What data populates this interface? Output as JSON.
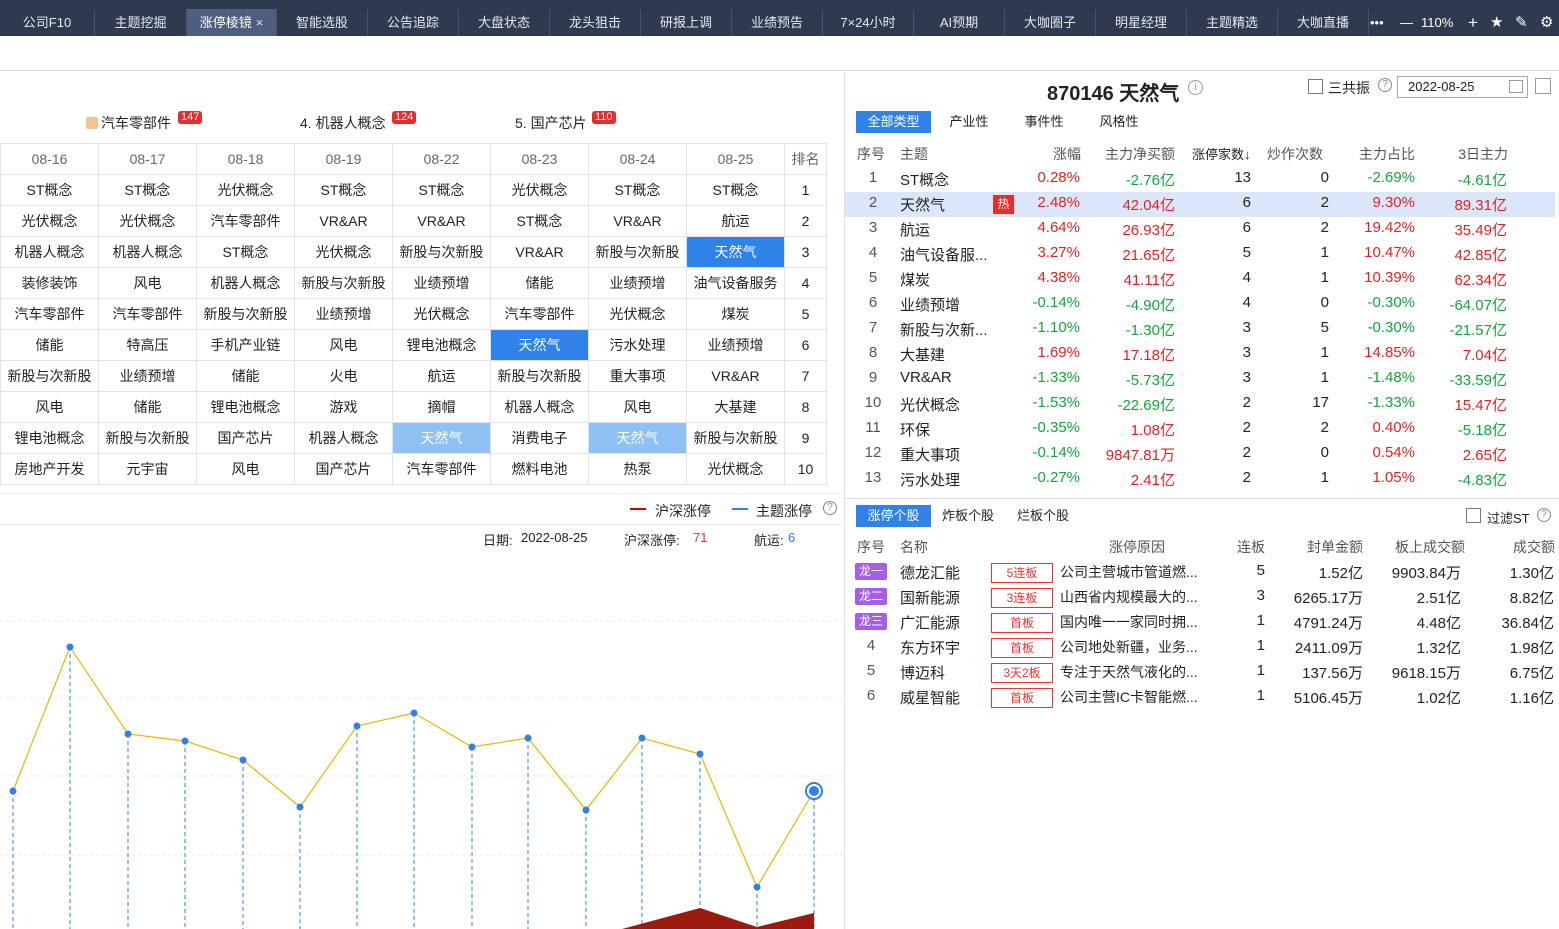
{
  "tabs": [
    "公司F10",
    "主题挖掘",
    "涨停棱镜",
    "智能选股",
    "公告追踪",
    "大盘状态",
    "龙头狙击",
    "研报上调",
    "业绩预告",
    "7×24小时",
    "AI预期",
    "大咖圈子",
    "明星经理",
    "主题精选",
    "大咖直播"
  ],
  "active_tab": "涨停棱镜",
  "toolbar": {
    "more": "•••",
    "minus": "—",
    "zoom": "110%",
    "plus": "+",
    "star": "★",
    "edit": "✎",
    "settings": "⚙"
  },
  "legend": [
    {
      "label": "汽车零部件",
      "count": "147"
    },
    {
      "label": "4. 机器人概念",
      "count": "124"
    },
    {
      "label": "5. 国产芯片",
      "count": "110"
    }
  ],
  "grid": {
    "dates": [
      "08-16",
      "08-17",
      "08-18",
      "08-19",
      "08-22",
      "08-23",
      "08-24",
      "08-25"
    ],
    "rank_header": "排名",
    "rows": [
      [
        "ST概念",
        "ST概念",
        "光伏概念",
        "ST概念",
        "ST概念",
        "光伏概念",
        "ST概念",
        "ST概念",
        "1"
      ],
      [
        "光伏概念",
        "光伏概念",
        "汽车零部件",
        "VR&AR",
        "VR&AR",
        "ST概念",
        "VR&AR",
        "航运",
        "2"
      ],
      [
        "机器人概念",
        "机器人概念",
        "ST概念",
        "光伏概念",
        "新股与次新股",
        "VR&AR",
        "新股与次新股",
        "天然气",
        "3"
      ],
      [
        "装修装饰",
        "风电",
        "机器人概念",
        "新股与次新股",
        "业绩预增",
        "储能",
        "业绩预增",
        "油气设备服务",
        "4"
      ],
      [
        "汽车零部件",
        "汽车零部件",
        "新股与次新股",
        "业绩预增",
        "光伏概念",
        "汽车零部件",
        "光伏概念",
        "煤炭",
        "5"
      ],
      [
        "储能",
        "特高压",
        "手机产业链",
        "风电",
        "锂电池概念",
        "天然气",
        "污水处理",
        "业绩预增",
        "6"
      ],
      [
        "新股与次新股",
        "业绩预增",
        "储能",
        "火电",
        "航运",
        "新股与次新股",
        "重大事项",
        "VR&AR",
        "7"
      ],
      [
        "风电",
        "储能",
        "锂电池概念",
        "游戏",
        "摘帽",
        "机器人概念",
        "风电",
        "大基建",
        "8"
      ],
      [
        "锂电池概念",
        "新股与次新股",
        "国产芯片",
        "机器人概念",
        "天然气",
        "消费电子",
        "天然气",
        "新股与次新股",
        "9"
      ],
      [
        "房地产开发",
        "元宇宙",
        "风电",
        "国产芯片",
        "汽车零部件",
        "燃料电池",
        "热泵",
        "光伏概念",
        "10"
      ]
    ]
  },
  "chart": {
    "legend_a": "沪深涨停",
    "legend_b": "主题涨停",
    "date_label": "日期:",
    "date": "2022-08-25",
    "limit_label": "沪深涨停:",
    "limit_value": "71",
    "topic_label": "航运:",
    "topic_value": "6"
  },
  "chart_data": {
    "type": "line",
    "series": [
      {
        "name": "主题涨停",
        "values": [
          3,
          9,
          5,
          5,
          4,
          2,
          6,
          7,
          6,
          6,
          2,
          6,
          5,
          0,
          3
        ]
      }
    ]
  },
  "right": {
    "title": "870146 天然气",
    "resonance": "三共振",
    "date_input": "2022-08-25",
    "filters": [
      "全部类型",
      "产业性",
      "事件性",
      "风格性"
    ],
    "headers": [
      "序号",
      "主题",
      "涨幅",
      "主力净买额",
      "涨停家数↓",
      "炒作次数",
      "主力占比",
      "3日主力"
    ],
    "rows": [
      [
        "1",
        "ST概念",
        "0.28%",
        "-2.76亿",
        "13",
        "0",
        "-2.69%",
        "-4.61亿"
      ],
      [
        "2",
        "天然气",
        "2.48%",
        "42.04亿",
        "6",
        "2",
        "9.30%",
        "89.31亿"
      ],
      [
        "3",
        "航运",
        "4.64%",
        "26.93亿",
        "6",
        "2",
        "19.42%",
        "35.49亿"
      ],
      [
        "4",
        "油气设备服...",
        "3.27%",
        "21.65亿",
        "5",
        "1",
        "10.47%",
        "42.85亿"
      ],
      [
        "5",
        "煤炭",
        "4.38%",
        "41.11亿",
        "4",
        "1",
        "10.39%",
        "62.34亿"
      ],
      [
        "6",
        "业绩预增",
        "-0.14%",
        "-4.90亿",
        "4",
        "0",
        "-0.30%",
        "-64.07亿"
      ],
      [
        "7",
        "新股与次新...",
        "-1.10%",
        "-1.30亿",
        "3",
        "5",
        "-0.30%",
        "-21.57亿"
      ],
      [
        "8",
        "大基建",
        "1.69%",
        "17.18亿",
        "3",
        "1",
        "14.85%",
        "7.04亿"
      ],
      [
        "9",
        "VR&AR",
        "-1.33%",
        "-5.73亿",
        "3",
        "1",
        "-1.48%",
        "-33.59亿"
      ],
      [
        "10",
        "光伏概念",
        "-1.53%",
        "-22.69亿",
        "2",
        "17",
        "-1.33%",
        "15.47亿"
      ],
      [
        "11",
        "环保",
        "-0.35%",
        "1.08亿",
        "2",
        "2",
        "0.40%",
        "-5.18亿"
      ],
      [
        "12",
        "重大事项",
        "-0.14%",
        "9847.81万",
        "2",
        "0",
        "0.54%",
        "2.65亿"
      ],
      [
        "13",
        "污水处理",
        "-0.27%",
        "2.41亿",
        "2",
        "1",
        "1.05%",
        "-4.83亿"
      ]
    ],
    "hot_label": "热",
    "stock_tabs": [
      "涨停个股",
      "炸板个股",
      "烂板个股"
    ],
    "filter_st": "过滤ST",
    "stock_headers": [
      "序号",
      "名称",
      "涨停原因",
      "连板",
      "封单金额",
      "板上成交额",
      "成交额"
    ],
    "stocks": [
      [
        "龙一",
        "德龙汇能",
        "5连板",
        "公司主营城市管道燃...",
        "5",
        "1.52亿",
        "9903.84万",
        "1.30亿"
      ],
      [
        "龙二",
        "国新能源",
        "3连板",
        "山西省内规模最大的...",
        "3",
        "6265.17万",
        "2.51亿",
        "8.82亿"
      ],
      [
        "龙三",
        "广汇能源",
        "首板",
        "国内唯一一家同时拥...",
        "1",
        "4791.24万",
        "4.48亿",
        "36.84亿"
      ],
      [
        "4",
        "东方环宇",
        "首板",
        "公司地处新疆，业务...",
        "1",
        "2411.09万",
        "1.32亿",
        "1.98亿"
      ],
      [
        "5",
        "博迈科",
        "3天2板",
        "专注于天然气液化的...",
        "1",
        "137.56万",
        "9618.15万",
        "6.75亿"
      ],
      [
        "6",
        "威星智能",
        "首板",
        "公司主营IC卡智能燃...",
        "1",
        "5106.45万",
        "1.02亿",
        "1.16亿"
      ]
    ]
  },
  "colors": {
    "accent": "#2f82e8",
    "up": "#e62020",
    "down": "#11a63a",
    "line": "#f0b400"
  }
}
